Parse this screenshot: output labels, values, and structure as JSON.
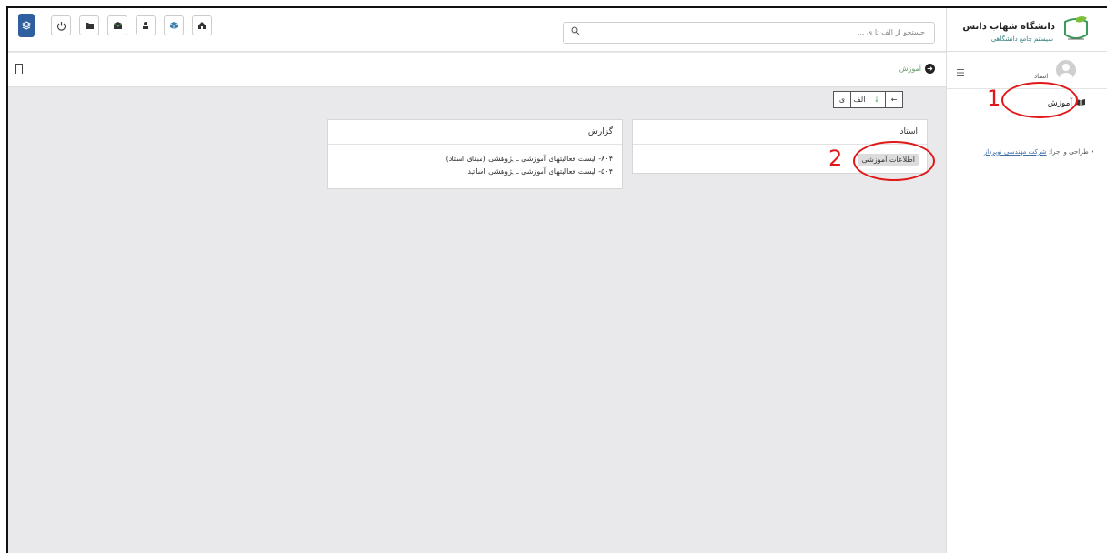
{
  "topbar": {
    "search_placeholder": "جستجو از الف تا ی ...",
    "buttons": [
      "power-icon",
      "folder-icon",
      "inbox-icon",
      "user-icon",
      "cube-icon",
      "home-icon"
    ],
    "first_button_icon": "layers-icon"
  },
  "breadcrumb": {
    "current": "آموزش"
  },
  "nav": {
    "alef": "الف",
    "ye": "ی"
  },
  "ostad_panel": {
    "title": "استاد",
    "tag": "اطلاعات آموزشی"
  },
  "report_panel": {
    "title": "گزارش",
    "items": [
      "۸۰۴- لیست فعالیتهای آموزشی ـ پژوهشی (مبنای استاد)",
      "۵۰۴- لیست فعالیتهای آموزشی ـ پژوهشی اساتید"
    ]
  },
  "sidebar": {
    "uni_name": "دانشگاه شهاب دانش",
    "uni_sub": "سیستم جامع دانشگاهی",
    "role": "استاد",
    "menu_item": "آموزش",
    "credit_prefix": "طراحی و اجرا:",
    "credit_link": "شرکت مهندسی نوپرداز"
  },
  "annotations": {
    "n1": "1",
    "n2": "2"
  },
  "colors": {
    "annotation": "#e01818",
    "accent": "#2f5f9e",
    "green": "#6aa26a"
  }
}
